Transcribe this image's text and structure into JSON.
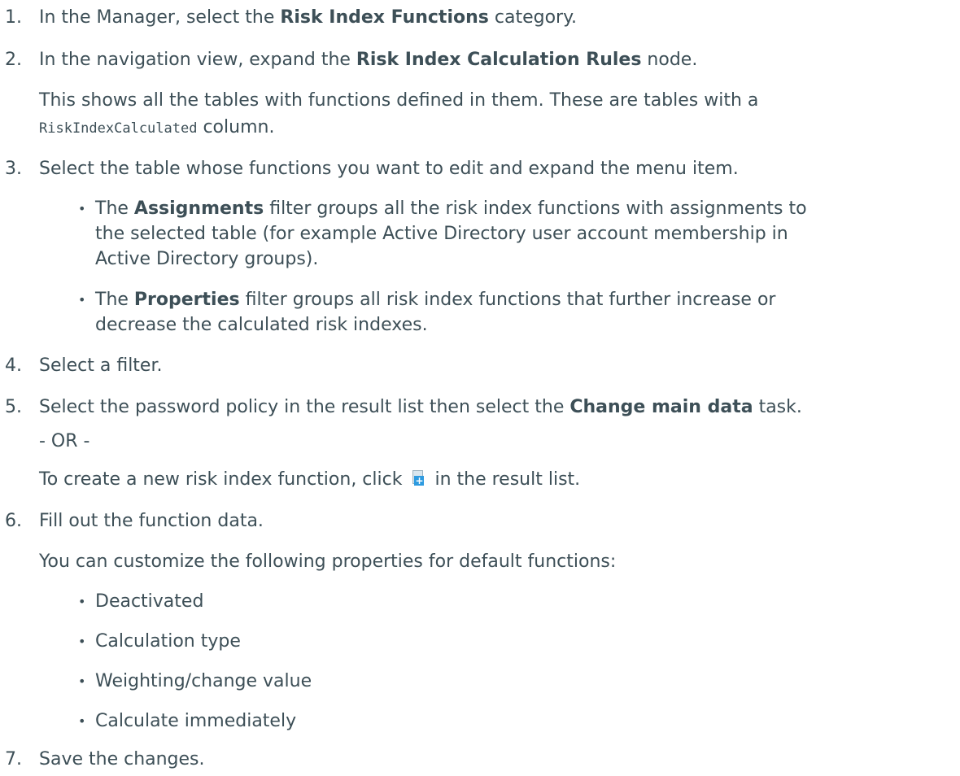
{
  "steps": [
    {
      "num": "1.",
      "pre": "In the Manager, select the ",
      "bold": "Risk Index Functions",
      "post": " category."
    },
    {
      "num": "2.",
      "pre": "In the navigation view, expand the ",
      "bold": "Risk Index Calculation Rules",
      "post": " node."
    },
    {
      "line1": "This shows all the tables with functions defined in them. These are tables with a",
      "code": "RiskIndexCalculated",
      "line2post": " column."
    },
    {
      "num": "3.",
      "text": "Select the table whose functions you want to edit and expand the menu item."
    },
    {
      "pre": "The ",
      "bold": "Assignments",
      "post": " filter groups all the risk index functions with assignments to",
      "line2": "the selected table (for example Active Directory user account membership in",
      "line3": "Active Directory groups)."
    },
    {
      "pre": "The ",
      "bold": "Properties",
      "post": " filter groups all risk index functions that further increase or",
      "line2": "decrease the calculated risk indexes."
    },
    {
      "num": "4.",
      "text": "Select a filter."
    },
    {
      "num": "5.",
      "pre": "Select the password policy in the result list then select the ",
      "bold": "Change main data",
      "post": " task."
    },
    {
      "or": "- OR -"
    },
    {
      "pre": "To create a new risk index function, click ",
      "post": " in the result list.",
      "icon": "add-document-icon"
    },
    {
      "num": "6.",
      "text": "Fill out the function data."
    },
    {
      "text": "You can customize the following properties for default functions:"
    },
    {
      "bullets": [
        "Deactivated",
        "Calculation type",
        "Weighting/change value",
        "Calculate immediately"
      ]
    },
    {
      "num": "7.",
      "text": "Save the changes."
    }
  ],
  "bullet_char": "•",
  "colors": {
    "text": "#3d4f57",
    "icon_accent": "#2e9be0"
  }
}
